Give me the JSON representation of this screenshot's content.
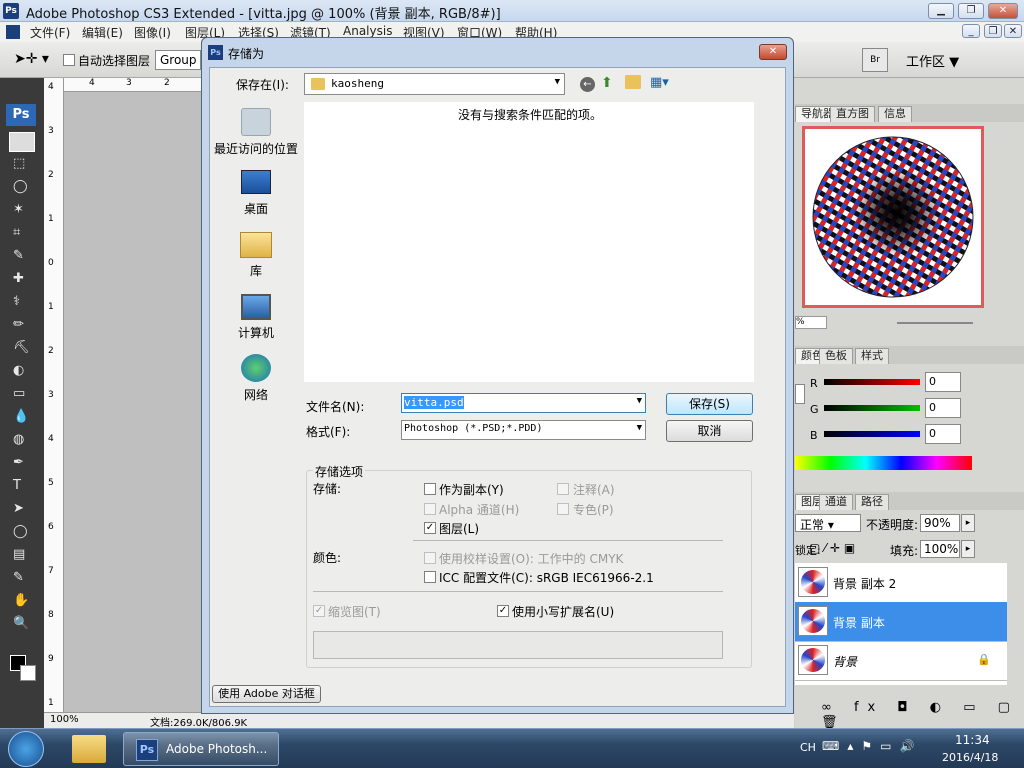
{
  "app": {
    "title": "Adobe Photoshop CS3 Extended - [vitta.jpg @ 100% (背景 副本, RGB/8#)]",
    "ps": "Ps",
    "workspace": "工作区 ▼"
  },
  "menu": [
    "文件(F)",
    "编辑(E)",
    "图像(I)",
    "图层(L)",
    "选择(S)",
    "滤镜(T)",
    "Analysis",
    "视图(V)",
    "窗口(W)",
    "帮助(H)"
  ],
  "options": {
    "auto_select": "自动选择图层",
    "group": "Group"
  },
  "ruler": {
    "h": [
      "4",
      "3",
      "2"
    ],
    "v": [
      "4",
      "3",
      "2",
      "1",
      "0",
      "1",
      "2",
      "3",
      "4",
      "5",
      "6",
      "7",
      "8",
      "9",
      "1"
    ]
  },
  "status": {
    "zoom": "100%",
    "doc": "文档:269.0K/806.9K"
  },
  "dialog": {
    "title": "存储为",
    "save_in_label": "保存在(I):",
    "folder": "kaosheng",
    "empty_msg": "没有与搜索条件匹配的项。",
    "places": [
      "最近访问的位置",
      "桌面",
      "库",
      "计算机",
      "网络"
    ],
    "filename_label": "文件名(N):",
    "filename": "vitta.psd",
    "format_label": "格式(F):",
    "format": "Photoshop (*.PSD;*.PDD)",
    "save_btn": "保存(S)",
    "cancel_btn": "取消",
    "options_title": "存储选项",
    "store_label": "存储:",
    "as_copy": "作为副本(Y)",
    "notes": "注释(A)",
    "alpha": "Alpha 通道(H)",
    "spot": "专色(P)",
    "layers": "图层(L)",
    "color_label": "颜色:",
    "proof": "使用校样设置(O): 工作中的 CMYK",
    "icc": "ICC 配置文件(C): sRGB IEC61966-2.1",
    "thumbnail": "缩览图(T)",
    "lowercase": "使用小写扩展名(U)",
    "use_adobe": "使用 Adobe 对话框"
  },
  "panels": {
    "nav_tabs": [
      "导航器",
      "直方图",
      "信息"
    ],
    "nav_zoom": "%",
    "color_tabs": [
      "颜色",
      "色板",
      "样式"
    ],
    "rgb": [
      {
        "label": "R",
        "value": "0",
        "color": "#ff0000"
      },
      {
        "label": "G",
        "value": "0",
        "color": "#00c000"
      },
      {
        "label": "B",
        "value": "0",
        "color": "#0000ff"
      }
    ],
    "layer_tabs": [
      "图层",
      "通道",
      "路径"
    ],
    "blend": "正常",
    "opacity_label": "不透明度:",
    "opacity": "90%",
    "lock_label": "锁定:",
    "fill_label": "填充:",
    "fill": "100%",
    "layers": [
      {
        "name": "背景 副本 2",
        "selected": false
      },
      {
        "name": "背景 副本",
        "selected": true
      },
      {
        "name": "背景",
        "selected": false
      }
    ]
  },
  "taskbar": {
    "app": "Adobe Photosh...",
    "lang": "CH",
    "time": "11:34",
    "date": "2016/4/18"
  }
}
